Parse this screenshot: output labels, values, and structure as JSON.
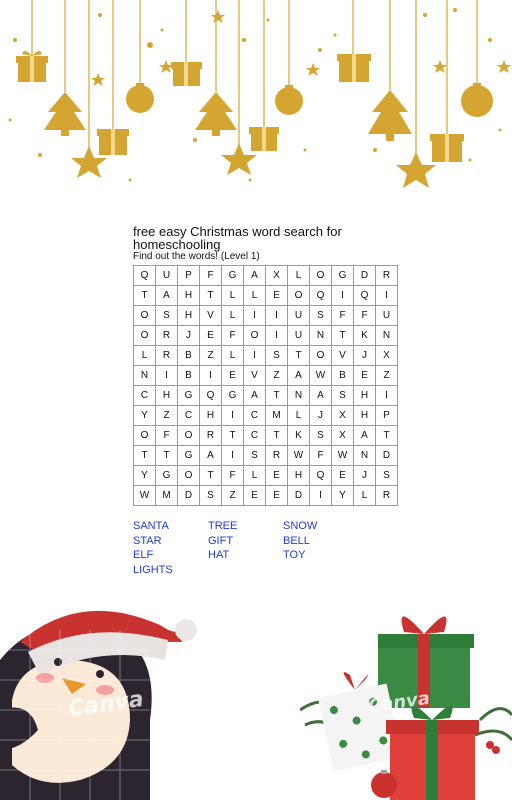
{
  "worksheet": {
    "title": "free easy Christmas word search for homeschooling",
    "subtitle": "Find out the words! (Level 1)"
  },
  "grid": [
    [
      "Q",
      "U",
      "P",
      "F",
      "G",
      "A",
      "X",
      "L",
      "O",
      "G",
      "D",
      "R"
    ],
    [
      "T",
      "A",
      "H",
      "T",
      "L",
      "L",
      "E",
      "O",
      "Q",
      "I",
      "Q",
      "I"
    ],
    [
      "O",
      "S",
      "H",
      "V",
      "L",
      "I",
      "I",
      "U",
      "S",
      "F",
      "F",
      "U"
    ],
    [
      "O",
      "R",
      "J",
      "E",
      "F",
      "O",
      "I",
      "U",
      "N",
      "T",
      "K",
      "N"
    ],
    [
      "L",
      "R",
      "B",
      "Z",
      "L",
      "I",
      "S",
      "T",
      "O",
      "V",
      "J",
      "X"
    ],
    [
      "N",
      "I",
      "B",
      "I",
      "E",
      "V",
      "Z",
      "A",
      "W",
      "B",
      "E",
      "Z"
    ],
    [
      "C",
      "H",
      "G",
      "Q",
      "G",
      "A",
      "T",
      "N",
      "A",
      "S",
      "H",
      "I"
    ],
    [
      "Y",
      "Z",
      "C",
      "H",
      "I",
      "C",
      "M",
      "L",
      "J",
      "X",
      "H",
      "P"
    ],
    [
      "O",
      "F",
      "O",
      "R",
      "T",
      "C",
      "T",
      "K",
      "S",
      "X",
      "A",
      "T"
    ],
    [
      "T",
      "T",
      "G",
      "A",
      "I",
      "S",
      "R",
      "W",
      "F",
      "W",
      "N",
      "D"
    ],
    [
      "Y",
      "G",
      "O",
      "T",
      "F",
      "L",
      "E",
      "H",
      "Q",
      "E",
      "J",
      "S"
    ],
    [
      "W",
      "M",
      "D",
      "S",
      "Z",
      "E",
      "E",
      "D",
      "I",
      "Y",
      "L",
      "R"
    ]
  ],
  "words": [
    "SANTA",
    "TREE",
    "SNOW",
    "STAR",
    "GIFT",
    "BELL",
    "ELF",
    "HAT",
    "TOY",
    "LIGHTS"
  ],
  "watermark": "Canva",
  "colors": {
    "gold": "#D4A531",
    "word_blue": "#1f3bd6",
    "hat_red": "#c8322f",
    "gift_green": "#2f7d3a"
  },
  "icons": [
    "gift-icon",
    "christmas-tree-icon",
    "ornament-ball-icon",
    "star-icon",
    "penguin-illustration",
    "gift-stack-illustration"
  ]
}
